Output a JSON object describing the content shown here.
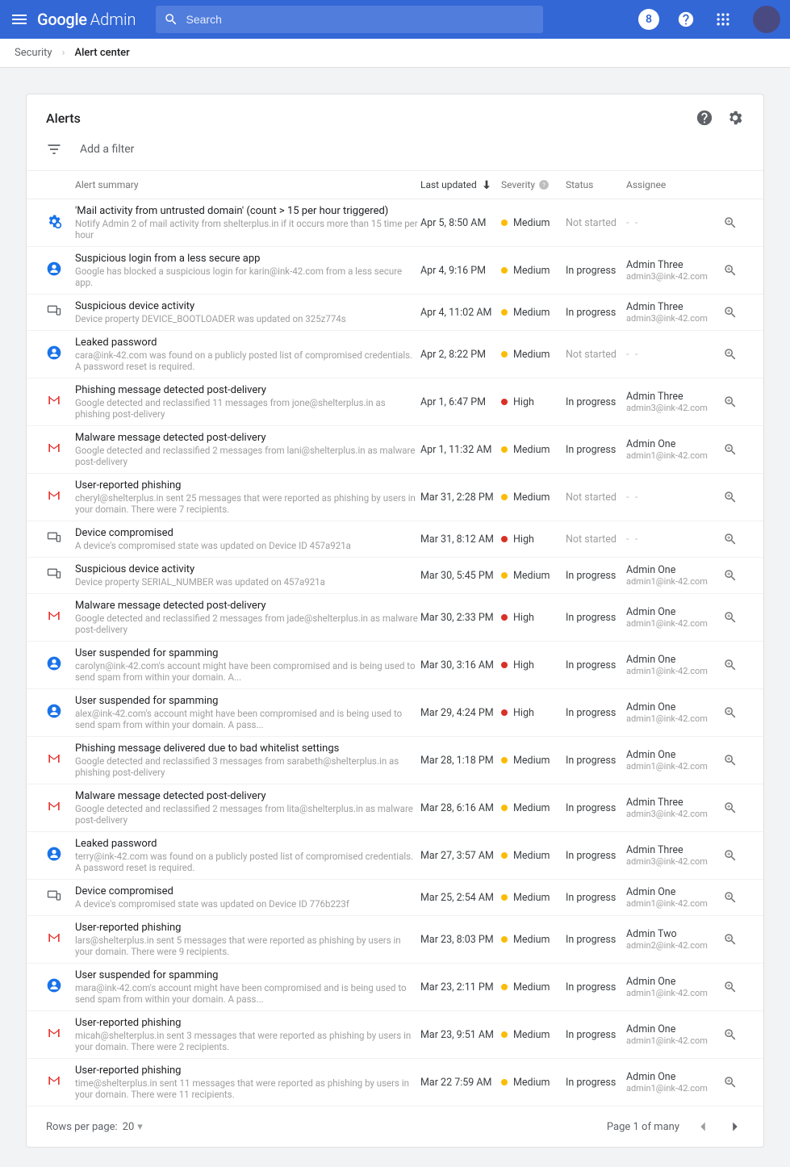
{
  "header": {
    "logo_google": "Google",
    "logo_admin": "Admin",
    "search_placeholder": "Search",
    "account_letter": "8"
  },
  "breadcrumb": {
    "parent": "Security",
    "current": "Alert center"
  },
  "panel": {
    "title": "Alerts",
    "filter": "Add a filter"
  },
  "columns": {
    "summary": "Alert summary",
    "updated": "Last updated",
    "severity": "Severity",
    "status": "Status",
    "assignee": "Assignee"
  },
  "footer": {
    "rows_label": "Rows per page:",
    "rows_value": "20",
    "page_label": "Page 1 of many"
  },
  "alerts": [
    {
      "icon": "gear-badge",
      "title": "'Mail activity from untrusted domain'  (count > 15 per hour triggered)",
      "sub": "Notify Admin 2 of mail activity from shelterplus.in if it occurs more than 15 time per hour",
      "updated": "Apr 5, 8:50 AM",
      "sev": "Medium",
      "status": "Not started",
      "assignee_name": "",
      "assignee_mail": ""
    },
    {
      "icon": "user",
      "title": "Suspicious login from a less secure app",
      "sub": "Google has blocked a suspicious login for karin@ink-42.com from a less secure app.",
      "updated": "Apr 4, 9:16 PM",
      "sev": "Medium",
      "status": "In progress",
      "assignee_name": "Admin Three",
      "assignee_mail": "admin3@ink-42.com"
    },
    {
      "icon": "device",
      "title": "Suspicious device activity",
      "sub": "Device property DEVICE_BOOTLOADER was updated on 325z774s",
      "updated": "Apr 4, 11:02 AM",
      "sev": "Medium",
      "status": "In progress",
      "assignee_name": "Admin Three",
      "assignee_mail": "admin3@ink-42.com"
    },
    {
      "icon": "user",
      "title": "Leaked password",
      "sub": "cara@ink-42.com was found on a publicly posted list of compromised credentials. A password reset is required.",
      "updated": "Apr 2, 8:22 PM",
      "sev": "Medium",
      "status": "Not started",
      "assignee_name": "",
      "assignee_mail": ""
    },
    {
      "icon": "gmail",
      "title": "Phishing message detected post-delivery",
      "sub": "Google detected and reclassified 11 messages from jone@shelterplus.in as phishing post-delivery",
      "updated": "Apr 1, 6:47 PM",
      "sev": "High",
      "status": "In progress",
      "assignee_name": "Admin Three",
      "assignee_mail": "admin3@ink-42.com"
    },
    {
      "icon": "gmail",
      "title": "Malware message detected post-delivery",
      "sub": "Google detected and reclassified 2 messages from lani@shelterplus.in as malware post-delivery",
      "updated": "Apr 1, 11:32 AM",
      "sev": "Medium",
      "status": "In progress",
      "assignee_name": "Admin One",
      "assignee_mail": "admin1@ink-42.com"
    },
    {
      "icon": "gmail",
      "title": "User-reported phishing",
      "sub": "cheryl@shelterplus.in sent 25 messages that were reported as phishing by users in your domain. There were 7 recipients.",
      "updated": "Mar 31, 2:28 PM",
      "sev": "Medium",
      "status": "Not started",
      "assignee_name": "",
      "assignee_mail": ""
    },
    {
      "icon": "device",
      "title": "Device compromised",
      "sub": "A device's compromised state was updated on Device ID 457a921a",
      "updated": "Mar 31, 8:12 AM",
      "sev": "High",
      "status": "Not started",
      "assignee_name": "",
      "assignee_mail": ""
    },
    {
      "icon": "device",
      "title": "Suspicious device activity",
      "sub": "Device property SERIAL_NUMBER was updated on 457a921a",
      "updated": "Mar 30, 5:45 PM",
      "sev": "Medium",
      "status": "In progress",
      "assignee_name": "Admin One",
      "assignee_mail": "admin1@ink-42.com"
    },
    {
      "icon": "gmail",
      "title": "Malware message detected post-delivery",
      "sub": "Google detected and reclassified 2 messages from jade@shelterplus.in as malware post-delivery",
      "updated": "Mar 30, 2:33 PM",
      "sev": "High",
      "status": "In progress",
      "assignee_name": "Admin One",
      "assignee_mail": "admin1@ink-42.com"
    },
    {
      "icon": "user",
      "title": "User suspended for spamming",
      "sub": "carolyn@ink-42.com's account might have been compromised and is being used to send spam from within your domain. A...",
      "updated": "Mar 30, 3:16 AM",
      "sev": "High",
      "status": "In progress",
      "assignee_name": "Admin One",
      "assignee_mail": "admin1@ink-42.com"
    },
    {
      "icon": "user",
      "title": "User suspended for spamming",
      "sub": "alex@ink-42.com's account might have been compromised and is being used to send spam from within your domain. A pass...",
      "updated": "Mar 29, 4:24 PM",
      "sev": "High",
      "status": "In progress",
      "assignee_name": "Admin One",
      "assignee_mail": "admin1@ink-42.com"
    },
    {
      "icon": "gmail",
      "title": "Phishing message delivered due to bad whitelist settings",
      "sub": "Google detected and reclassified 3 messages from sarabeth@shelterplus.in as phishing post-delivery",
      "updated": "Mar 28, 1:18 PM",
      "sev": "Medium",
      "status": "In progress",
      "assignee_name": "Admin One",
      "assignee_mail": "admin1@ink-42.com"
    },
    {
      "icon": "gmail",
      "title": "Malware message detected post-delivery",
      "sub": "Google detected and reclassified 2 messages from lita@shelterplus.in as malware post-delivery",
      "updated": "Mar 28, 6:16 AM",
      "sev": "Medium",
      "status": "In progress",
      "assignee_name": "Admin Three",
      "assignee_mail": "admin3@ink-42.com"
    },
    {
      "icon": "user",
      "title": "Leaked password",
      "sub": "terry@ink-42.com was found on a publicly posted list of compromised credentials. A password reset is required.",
      "updated": "Mar 27, 3:57 AM",
      "sev": "Medium",
      "status": "In progress",
      "assignee_name": "Admin Three",
      "assignee_mail": "admin3@ink-42.com"
    },
    {
      "icon": "device",
      "title": "Device compromised",
      "sub": "A device's compromised state was updated on Device ID 776b223f",
      "updated": "Mar 25, 2:54 AM",
      "sev": "Medium",
      "status": "In progress",
      "assignee_name": "Admin One",
      "assignee_mail": "admin1@ink-42.com"
    },
    {
      "icon": "gmail",
      "title": "User-reported phishing",
      "sub": "lars@shelterplus.in sent 5 messages that were reported as phishing by users in your domain. There were 9 recipients.",
      "updated": "Mar 23, 8:03 PM",
      "sev": "Medium",
      "status": "In progress",
      "assignee_name": "Admin Two",
      "assignee_mail": "admin2@ink-42.com"
    },
    {
      "icon": "user",
      "title": "User suspended for spamming",
      "sub": "mara@ink-42.com's account might have been compromised and is being used to send spam from within your domain. A pass...",
      "updated": "Mar 23, 2:11 PM",
      "sev": "Medium",
      "status": "In progress",
      "assignee_name": "Admin One",
      "assignee_mail": "admin1@ink-42.com"
    },
    {
      "icon": "gmail",
      "title": "User-reported phishing",
      "sub": "micah@shelterplus.in sent 3 messages that were reported as phishing by users in your domain. There were 2 recipients.",
      "updated": "Mar 23, 9:51 AM",
      "sev": "Medium",
      "status": "In progress",
      "assignee_name": "Admin One",
      "assignee_mail": "admin1@ink-42.com"
    },
    {
      "icon": "gmail",
      "title": "User-reported phishing",
      "sub": "time@shelterplus.in sent 11 messages that were reported as phishing by users in your domain. There were 11 recipients.",
      "updated": "Mar 22 7:59 AM",
      "sev": "Medium",
      "status": "In progress",
      "assignee_name": "Admin One",
      "assignee_mail": "admin1@ink-42.com"
    }
  ]
}
